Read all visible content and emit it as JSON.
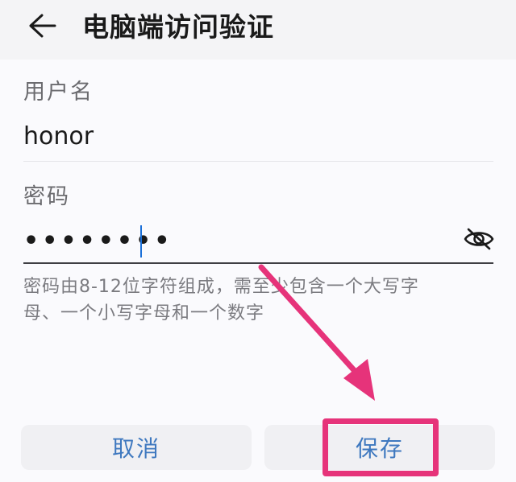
{
  "header": {
    "title": "电脑端访问验证",
    "back_icon": "arrow-left-icon"
  },
  "form": {
    "username_label": "用户名",
    "username_value": "honor",
    "password_label": "密码",
    "password_masked": "••••••••",
    "visibility_icon": "eye-off-icon",
    "hint_line1": "密码由8-12位字符组成，需至少包含一个大写字",
    "hint_line2": "母、一个小写字母和一个数字"
  },
  "actions": {
    "cancel_label": "取消",
    "save_label": "保存"
  },
  "annotation": {
    "color": "#e6337a"
  },
  "colors": {
    "accent": "#3e78bf",
    "cursor": "#1a6fd8"
  }
}
